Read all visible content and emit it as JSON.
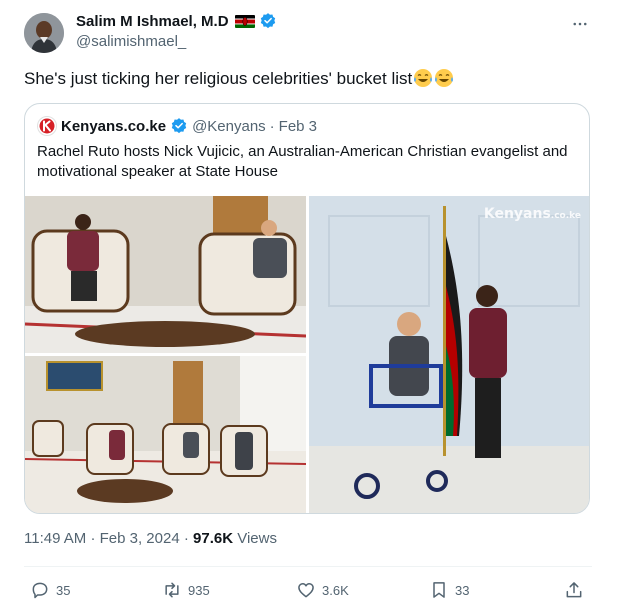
{
  "author": {
    "display_name": "Salim M Ishmael, M.D",
    "handle": "@salimishmael_",
    "flag_icon": "kenya-flag-icon",
    "verified": true
  },
  "tweet": {
    "text": "She's just ticking her religious celebrities' bucket list",
    "emoji": [
      "face-with-tears-of-joy",
      "face-with-tears-of-joy"
    ]
  },
  "quoted": {
    "display_name": "Kenyans.co.ke",
    "handle": "@Kenyans",
    "separator": "·",
    "date": "Feb 3",
    "text": "Rachel Ruto hosts Nick Vujicic, an Australian-American Christian evangelist and motivational speaker at State House",
    "media": [
      {
        "name": "photo-two-seated-in-armchairs"
      },
      {
        "name": "photo-wide-room-seating"
      },
      {
        "name": "photo-standing-by-flag"
      }
    ],
    "watermark_text": "Kenyans",
    "watermark_sub": ".co.ke"
  },
  "meta": {
    "time": "11:49 AM",
    "separator": "·",
    "date": "Feb 3, 2024",
    "separator2": "·",
    "views_count": "97.6K",
    "views_label": "Views"
  },
  "actions": {
    "replies": "35",
    "reposts": "935",
    "likes": "3.6K",
    "bookmarks": "33"
  },
  "colors": {
    "verified_blue": "#1d9bf0",
    "secondary_text": "#536471",
    "border": "#cfd9de",
    "kenyans_red": "#d62027"
  }
}
